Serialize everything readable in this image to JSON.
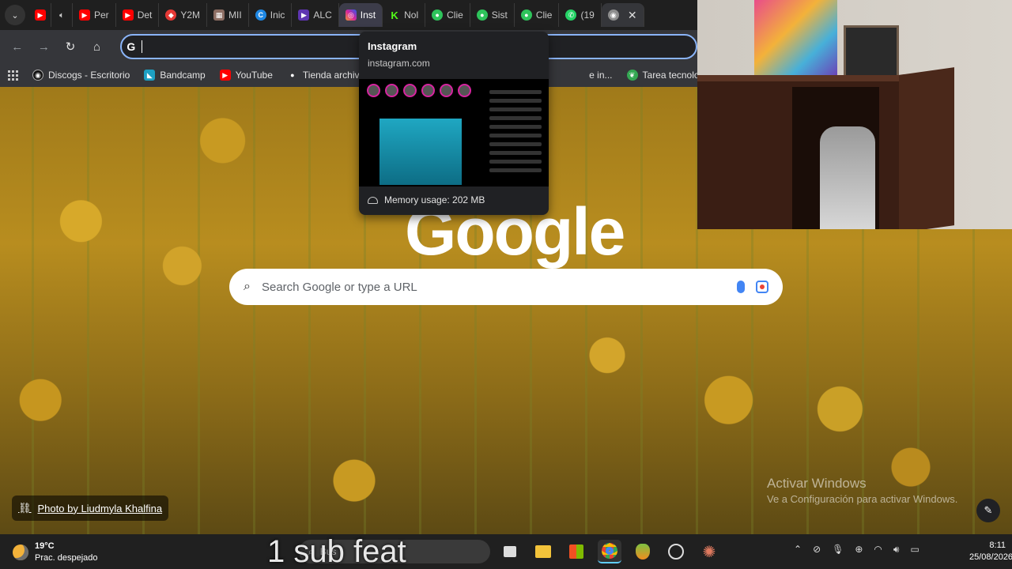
{
  "tabs": [
    {
      "label": "",
      "favicon": "youtube-icon",
      "color": "#ff0000"
    },
    {
      "label": "",
      "favicon": "speaker-icon",
      "color": "#cccccc"
    },
    {
      "label": "Per",
      "favicon": "youtube-icon",
      "color": "#ff0000"
    },
    {
      "label": "Det",
      "favicon": "youtube-icon",
      "color": "#ff0000"
    },
    {
      "label": "Y2M",
      "favicon": "y2mate-icon",
      "color": "#e53935"
    },
    {
      "label": "MII",
      "favicon": "image-icon",
      "color": "#8d6e63"
    },
    {
      "label": "Inic",
      "favicon": "canva-icon",
      "color": "#1e88e5"
    },
    {
      "label": "ALC",
      "favicon": "video-icon",
      "color": "#5e35b1"
    },
    {
      "label": "Inst",
      "favicon": "instagram-icon",
      "color": "#d6249f",
      "active": true
    },
    {
      "label": "Nol",
      "favicon": "kick-icon",
      "color": "#53fc18"
    },
    {
      "label": "Clie",
      "favicon": "green-circle-icon",
      "color": "#2ec45b"
    },
    {
      "label": "Sist",
      "favicon": "green-circle-icon",
      "color": "#2ec45b"
    },
    {
      "label": "Clie",
      "favicon": "green-circle-icon",
      "color": "#2ec45b"
    },
    {
      "label": "(19",
      "favicon": "whatsapp-icon",
      "color": "#25d366"
    },
    {
      "label": "",
      "favicon": "chrome-icon",
      "color": "#8e8e8e"
    }
  ],
  "bookmarks": [
    {
      "label": "Discogs - Escritorio",
      "icon": "discogs-icon"
    },
    {
      "label": "Bandcamp",
      "icon": "bandcamp-icon"
    },
    {
      "label": "YouTube",
      "icon": "youtube-icon"
    },
    {
      "label": "Tienda archivos",
      "icon": "tienda-icon"
    },
    {
      "label": "e in...",
      "icon": "bookmark-icon"
    },
    {
      "label": "Tarea tecnologia pe...",
      "icon": "leaf-icon"
    }
  ],
  "hovercard": {
    "title": "Instagram",
    "url": "instagram.com",
    "memory": "Memory usage: 202 MB"
  },
  "ntp": {
    "logo": "Google",
    "search_placeholder": "Search Google or type a URL",
    "photo_credit": "Photo by Liudmyla Khalfina"
  },
  "activation": {
    "line1": "Activar Windows",
    "line2": "Ve a Configuración para activar Windows."
  },
  "taskbar": {
    "temperature": "19°C",
    "weather": "Prac. despejado",
    "search_placeholder": "Bus",
    "time": "8:11",
    "date": "25/08/2026"
  },
  "caption": "1 sub feat"
}
